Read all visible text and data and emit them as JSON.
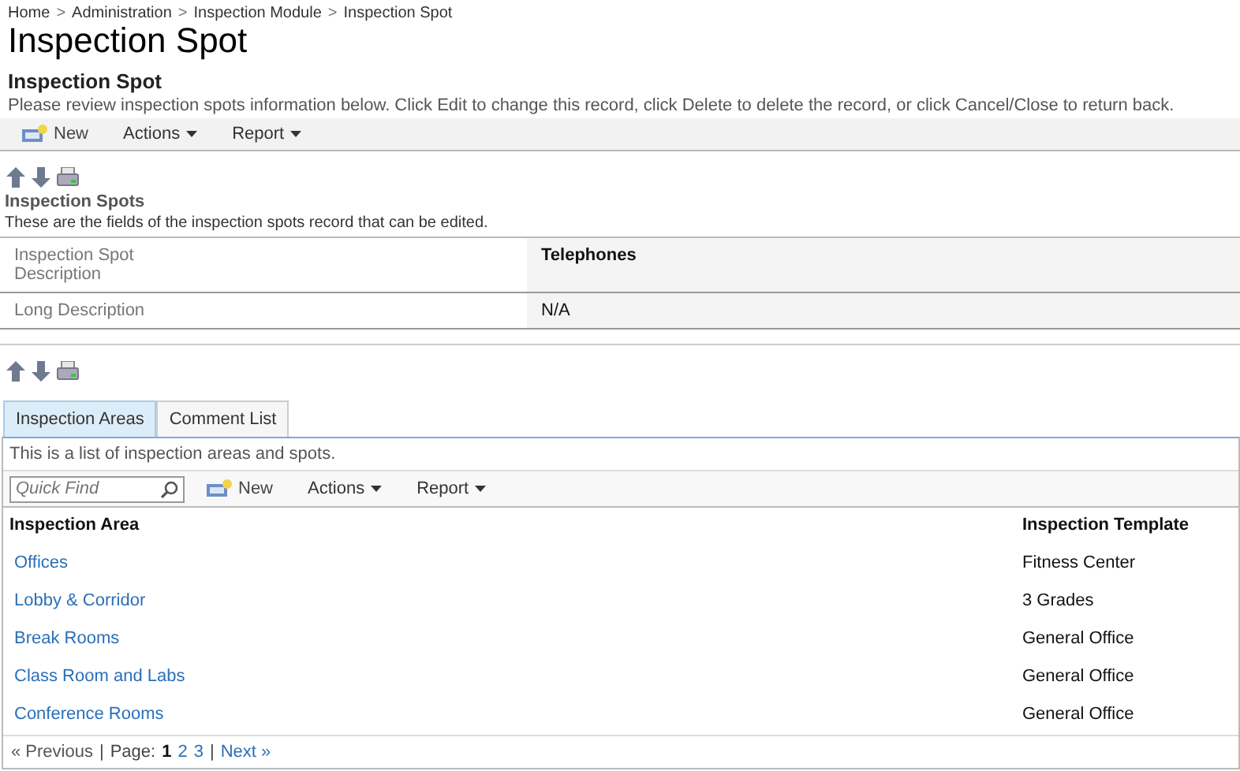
{
  "breadcrumb": [
    {
      "label": "Home",
      "separator": ">"
    },
    {
      "label": "Administration",
      "separator": ">"
    },
    {
      "label": "Inspection Module",
      "separator": ">"
    },
    {
      "label": "Inspection Spot"
    }
  ],
  "page_title": "Inspection Spot",
  "section_title": "Inspection Spot",
  "instructions": "Please review inspection spots information below. Click Edit to change this record, click Delete to delete the record, or click Cancel/Close to return back.",
  "toolbar": [
    {
      "label": "New",
      "kind": "new"
    },
    {
      "label": "Actions",
      "kind": "menu"
    },
    {
      "label": "Report",
      "kind": "menu"
    }
  ],
  "record": {
    "title": "Inspection Spots",
    "description": "These are the fields of the inspection spots record that can be edited.",
    "fields": [
      {
        "label": "Inspection Spot Description",
        "value": "Telephones",
        "bold": true
      },
      {
        "label": "Long Description",
        "value": "N/A",
        "bold": false
      }
    ]
  },
  "tabs": [
    {
      "label": "Inspection Areas",
      "selected": true
    },
    {
      "label": "Comment List",
      "selected": false
    }
  ],
  "list": {
    "description": "This is a list of inspection areas and spots.",
    "search": {
      "placeholder": "Quick Find"
    },
    "toolbar": [
      {
        "label": "New",
        "kind": "new"
      },
      {
        "label": "Actions",
        "kind": "menu"
      },
      {
        "label": "Report",
        "kind": "menu"
      }
    ],
    "columns": [
      "Inspection Area",
      "Inspection Template"
    ],
    "rows": [
      {
        "area": "Offices",
        "template": "Fitness Center"
      },
      {
        "area": "Lobby & Corridor",
        "template": "3 Grades"
      },
      {
        "area": "Break Rooms",
        "template": "General Office"
      },
      {
        "area": "Class Room and Labs",
        "template": "General Office"
      },
      {
        "area": "Conference Rooms",
        "template": "General Office"
      }
    ],
    "pagination": {
      "previous": {
        "label": "« Previous",
        "disabled": true
      },
      "separator_1": "|",
      "page_label": "Page:",
      "pages": [
        {
          "label": "1",
          "selected": true
        },
        {
          "label": "2",
          "selected": false
        },
        {
          "label": "3",
          "selected": false
        }
      ],
      "separator_2": "|",
      "next": {
        "label": "Next »",
        "disabled": false
      }
    }
  }
}
